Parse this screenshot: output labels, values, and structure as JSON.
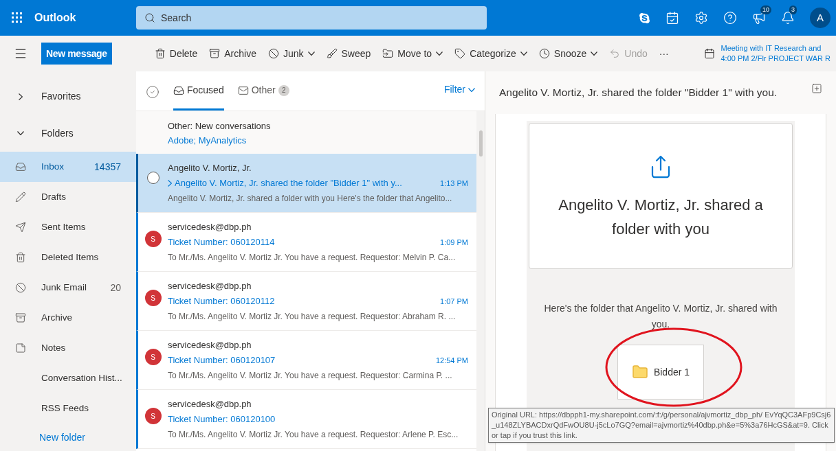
{
  "app": {
    "name": "Outlook",
    "search_placeholder": "Search",
    "notification_badges": [
      "10",
      "3"
    ],
    "avatar_initial": "A"
  },
  "toolbar": {
    "new_message": "New message",
    "actions": [
      {
        "label": "Delete",
        "dropdown": false,
        "disabled": false
      },
      {
        "label": "Archive",
        "dropdown": false,
        "disabled": false
      },
      {
        "label": "Junk",
        "dropdown": true,
        "disabled": false
      },
      {
        "label": "Sweep",
        "dropdown": false,
        "disabled": false
      },
      {
        "label": "Move to",
        "dropdown": true,
        "disabled": false
      },
      {
        "label": "Categorize",
        "dropdown": true,
        "disabled": false
      },
      {
        "label": "Snooze",
        "dropdown": true,
        "disabled": false
      },
      {
        "label": "Undo",
        "dropdown": false,
        "disabled": true
      }
    ],
    "more": "···",
    "reminder": {
      "title": "Meeting with IT Research and",
      "detail": "4:00 PM 2/Flr PROJECT WAR R"
    }
  },
  "sidebar": {
    "sections": [
      {
        "label": "Favorites",
        "expanded": false
      },
      {
        "label": "Folders",
        "expanded": true
      }
    ],
    "folders": [
      {
        "label": "Inbox",
        "count": "14357",
        "selected": true
      },
      {
        "label": "Drafts",
        "selected": false
      },
      {
        "label": "Sent Items",
        "selected": false
      },
      {
        "label": "Deleted Items",
        "selected": false
      },
      {
        "label": "Junk Email",
        "count": "20",
        "selected": false
      },
      {
        "label": "Archive",
        "selected": false
      },
      {
        "label": "Notes",
        "selected": false
      },
      {
        "label": "Conversation Hist...",
        "selected": false
      },
      {
        "label": "RSS Feeds",
        "selected": false
      }
    ],
    "new_folder": "New folder"
  },
  "message_list": {
    "tabs": [
      {
        "label": "Focused",
        "selected": true
      },
      {
        "label": "Other",
        "count": "2",
        "selected": false
      }
    ],
    "filter": "Filter",
    "other_notice": {
      "title": "Other: New conversations",
      "senders": "Adobe; MyAnalytics"
    },
    "messages": [
      {
        "sender": "Angelito V. Mortiz, Jr.",
        "subject": "Angelito V. Mortiz, Jr. shared the folder \"Bidder 1\" with y...",
        "time": "1:13 PM",
        "preview": "Angelito V. Mortiz, Jr. shared a folder with you Here's the folder that Angelito...",
        "selected": true
      },
      {
        "sender": "servicedesk@dbp.ph",
        "subject": "Ticket Number: 060120114",
        "time": "1:09 PM",
        "preview": "To Mr./Ms. Angelito V. Mortiz Jr. You have a request. Requestor: Melvin P. Ca...",
        "selected": false,
        "avatar": "S"
      },
      {
        "sender": "servicedesk@dbp.ph",
        "subject": "Ticket Number: 060120112",
        "time": "1:07 PM",
        "preview": "To Mr./Ms. Angelito V. Mortiz Jr. You have a request. Requestor: Abraham R. ...",
        "selected": false,
        "avatar": "S"
      },
      {
        "sender": "servicedesk@dbp.ph",
        "subject": "Ticket Number: 060120107",
        "time": "12:54 PM",
        "preview": "To Mr./Ms. Angelito V. Mortiz Jr. You have a request. Requestor: Carmina P. ...",
        "selected": false,
        "avatar": "S"
      },
      {
        "sender": "servicedesk@dbp.ph",
        "subject": "Ticket Number: 060120100",
        "preview": "To Mr./Ms. Angelito V. Mortiz Jr. You have a request. Requestor: Arlene P. Esc...",
        "selected": false,
        "avatar": "S"
      }
    ]
  },
  "reading_pane": {
    "subject": "Angelito V. Mortiz, Jr. shared the folder \"Bidder 1\" with you.",
    "card_title": "Angelito V. Mortiz, Jr. shared a folder with you",
    "card_text": "Here's the folder that Angelito V. Mortiz, Jr. shared with you.",
    "folder_name": "Bidder 1",
    "tooltip": "Original URL: https://dbpph1-my.sharepoint.com/:f:/g/personal/ajvmortiz_dbp_ph/ EvYqQC3AFp9Csj6_u148ZLYBACDxrQdFwOU8U-j5cLo7GQ?email=ajvmortiz%40dbp.ph&e=5%3a76HcGS&at=9. Click or tap if you trust this link."
  }
}
